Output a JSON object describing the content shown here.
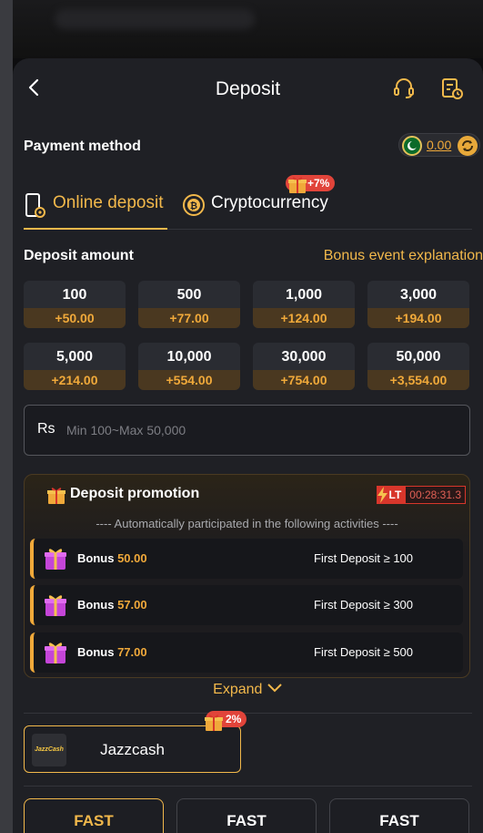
{
  "header": {
    "title": "Deposit"
  },
  "payment_method": {
    "label": "Payment method",
    "balance": "0.00"
  },
  "tabs": [
    {
      "label": "Online deposit",
      "active": true
    },
    {
      "label": "Cryptocurrency",
      "active": false,
      "bonus": "+7%"
    }
  ],
  "deposit_amount": {
    "label": "Deposit amount",
    "bonus_link": "Bonus event explanation",
    "chips": [
      {
        "value": "100",
        "bonus": "+50.00"
      },
      {
        "value": "500",
        "bonus": "+77.00"
      },
      {
        "value": "1,000",
        "bonus": "+124.00"
      },
      {
        "value": "3,000",
        "bonus": "+194.00"
      },
      {
        "value": "5,000",
        "bonus": "+214.00"
      },
      {
        "value": "10,000",
        "bonus": "+554.00"
      },
      {
        "value": "30,000",
        "bonus": "+754.00"
      },
      {
        "value": "50,000",
        "bonus": "+3,554.00"
      }
    ],
    "currency_symbol": "Rs",
    "input_placeholder": "Min 100~Max 50,000"
  },
  "promotion": {
    "title": "Deposit promotion",
    "badge": "LT",
    "timer": "00:28:31.3",
    "subtitle": "---- Automatically participated in the following activities ----",
    "items": [
      {
        "label": "Bonus",
        "value": "50.00",
        "condition": "First Deposit ≥ 100"
      },
      {
        "label": "Bonus",
        "value": "57.00",
        "condition": "First Deposit ≥ 300"
      },
      {
        "label": "Bonus",
        "value": "77.00",
        "condition": "First Deposit ≥ 500"
      }
    ],
    "expand_label": "Expand"
  },
  "methods": [
    {
      "name": "Jazzcash",
      "logo_text": "JazzCash",
      "bonus": "2%"
    }
  ],
  "channels": [
    {
      "label": "FAST",
      "active": true
    },
    {
      "label": "FAST",
      "active": false
    },
    {
      "label": "FAST",
      "active": false
    }
  ],
  "colors": {
    "accent": "#f2b84b",
    "bonus": "#f0a93a",
    "tag_red": "#e1443a",
    "panel": "#1f2025"
  }
}
